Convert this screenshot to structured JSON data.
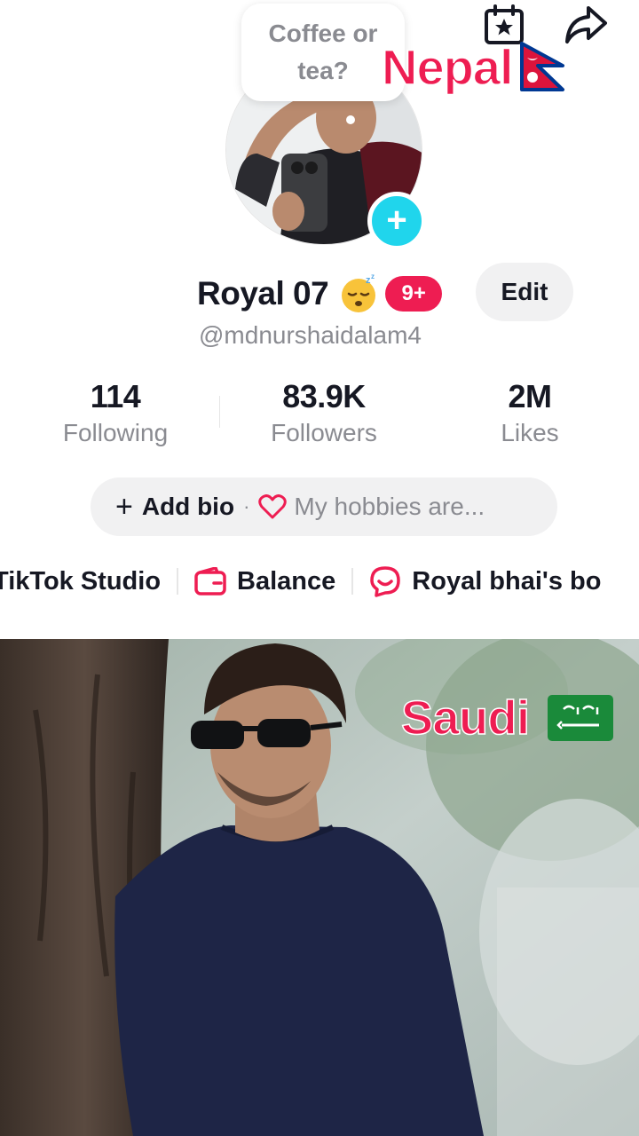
{
  "speech_bubble": {
    "text": "Coffee or tea?"
  },
  "overlays": {
    "top": {
      "text": "Nepal",
      "flag": "nepal-flag"
    },
    "bottom": {
      "text": "Saudi",
      "flag": "saudi-flag"
    }
  },
  "top_icons": [
    "calendar-star-icon",
    "share-icon"
  ],
  "profile": {
    "display_name": "Royal 07",
    "status_emoji": "sleeping-face-emoji",
    "badge": "9+",
    "edit_label": "Edit",
    "username": "@mdnurshaidalam4"
  },
  "stats": [
    {
      "value": "114",
      "label": "Following"
    },
    {
      "value": "83.9K",
      "label": "Followers"
    },
    {
      "value": "2M",
      "label": "Likes"
    }
  ],
  "bio": {
    "add_label": "Add bio",
    "separator": "·",
    "hobbies_placeholder": "My hobbies are..."
  },
  "quick_links": [
    {
      "label": "TikTok Studio",
      "icon": ""
    },
    {
      "label": "Balance",
      "icon": "wallet-icon"
    },
    {
      "label": "Royal bhai's bo",
      "icon": "chat-bubble-icon"
    }
  ],
  "colors": {
    "accent": "#ee1d52",
    "add_avatar": "#20d5ec",
    "secondary_text": "#8a8b91",
    "pill_bg": "#f1f1f2"
  }
}
